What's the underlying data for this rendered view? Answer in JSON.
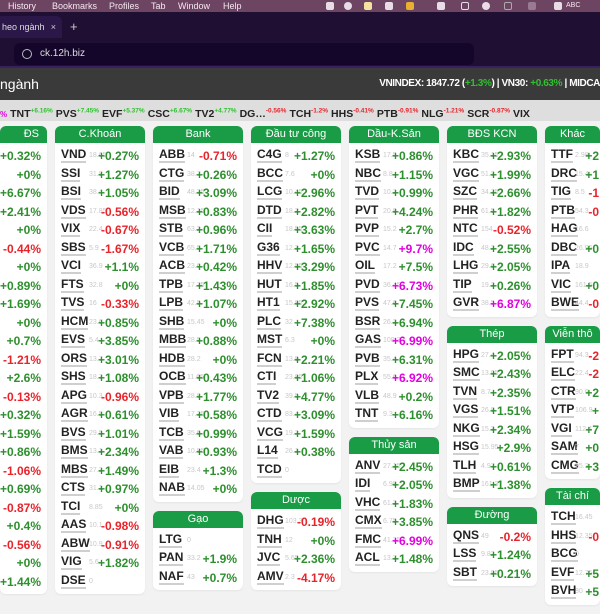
{
  "menubar": {
    "items": [
      "History",
      "Bookmarks",
      "Profiles",
      "Tab",
      "Window",
      "Help"
    ],
    "input_label": "ABC"
  },
  "browser": {
    "tab_title": "heo ngành",
    "tab_close": "×",
    "new_tab": "+",
    "url": "ck.12h.biz"
  },
  "header": {
    "title": "ngành",
    "vnindex_label": "VNINDEX: 1847.72 (",
    "vnindex_change": "+1.3%",
    "vn30_label": ") | VN30: ",
    "vn30_change": "+0.63%",
    "midcap_label": " | MIDCA"
  },
  "ticker_strip": [
    {
      "s": "%",
      "p": "",
      "c": "g"
    },
    {
      "s": "TNT",
      "p": "+6.16%",
      "c": "g"
    },
    {
      "s": "PVS",
      "p": "+7.45%",
      "c": "g"
    },
    {
      "s": "EVF",
      "p": "+5.37%",
      "c": "g"
    },
    {
      "s": "CSC",
      "p": "+6.67%",
      "c": "g"
    },
    {
      "s": "TV2",
      "p": "+4.77%",
      "c": "g"
    },
    {
      "s": "DG…",
      "p": "-0.56%",
      "c": "r"
    },
    {
      "s": "TCH",
      "p": "-1.2%",
      "c": "r"
    },
    {
      "s": "HHS",
      "p": "-0.41%",
      "c": "r"
    },
    {
      "s": "PTB",
      "p": "-0.91%",
      "c": "r"
    },
    {
      "s": "NLG",
      "p": "-1.21%",
      "c": "r"
    },
    {
      "s": "SCR",
      "p": "-0.87%",
      "c": "r"
    },
    {
      "s": "VIX",
      "p": "",
      "c": "g"
    }
  ],
  "colors": {
    "header": "#1a9c47",
    "up": "#2e8f2e",
    "down": "#e8232a",
    "ceiling": "#e100e1"
  },
  "columns": [
    [
      {
        "title": "ĐS",
        "rows": [
          [
            "",
            "",
            "+0.32%"
          ],
          [
            "",
            "",
            "+0%"
          ],
          [
            "",
            "",
            "+6.67%"
          ],
          [
            "",
            "",
            "+2.41%"
          ],
          [
            "",
            "",
            "+0%"
          ],
          [
            "",
            "",
            "-0.44%"
          ],
          [
            "",
            "",
            "+0%"
          ],
          [
            "",
            "",
            "+0.89%"
          ],
          [
            "",
            "",
            "+1.69%"
          ],
          [
            "",
            "",
            "+0%"
          ],
          [
            "",
            "",
            "+0.7%"
          ],
          [
            "",
            "",
            "-1.21%"
          ],
          [
            "",
            "",
            "+2.6%"
          ],
          [
            "",
            "",
            "-0.13%"
          ],
          [
            "",
            "",
            "+0.32%"
          ],
          [
            "",
            "",
            "+1.59%"
          ],
          [
            "",
            "",
            "+0.86%"
          ],
          [
            "",
            "",
            "-1.06%"
          ],
          [
            "",
            "",
            "+0.69%"
          ],
          [
            "",
            "",
            "-0.87%"
          ],
          [
            "",
            "",
            "+0.4%"
          ],
          [
            "",
            "",
            "-0.56%"
          ],
          [
            "",
            "",
            "+0%"
          ],
          [
            "",
            "",
            "+1.44%"
          ]
        ]
      }
    ],
    [
      {
        "title": "C.Khoán",
        "rows": [
          [
            "VND",
            "18.65",
            "+0.27%"
          ],
          [
            "SSI",
            "31.8",
            "+1.27%"
          ],
          [
            "BSI",
            "38.4",
            "+1.05%"
          ],
          [
            "VDS",
            "17.85",
            "-0.56%"
          ],
          [
            "VIX",
            "22.4",
            "-0.67%"
          ],
          [
            "SBS",
            "5.9",
            "-1.67%"
          ],
          [
            "VCI",
            "36.9",
            "+1.1%"
          ],
          [
            "FTS",
            "32.8",
            "+0%"
          ],
          [
            "TVS",
            "16",
            "-0.33%"
          ],
          [
            "HCM",
            "23.6",
            "+0.85%"
          ],
          [
            "EVS",
            "5.4",
            "+3.85%"
          ],
          [
            "ORS",
            "13.7",
            "+3.01%"
          ],
          [
            "SHS",
            "18.7",
            "+1.08%"
          ],
          [
            "APG",
            "10.3",
            "-0.96%"
          ],
          [
            "AGR",
            "16.5",
            "+0.61%"
          ],
          [
            "BVS",
            "29.5",
            "+1.01%"
          ],
          [
            "BMS",
            "13.1",
            "+2.34%"
          ],
          [
            "MBS",
            "27.2",
            "+1.49%"
          ],
          [
            "CTS",
            "31.1",
            "+0.97%"
          ],
          [
            "TCI",
            "8.85",
            "+0%"
          ],
          [
            "AAS",
            "10.1",
            "-0.98%"
          ],
          [
            "ABW",
            "10.9",
            "-0.91%"
          ],
          [
            "VIG",
            "5.6",
            "+1.82%"
          ],
          [
            "DSE",
            "0",
            ""
          ]
        ]
      }
    ],
    [
      {
        "title": "Bank",
        "rows": [
          [
            "ABB",
            "14",
            "-0.71%"
          ],
          [
            "CTG",
            "38.7",
            "+0.26%"
          ],
          [
            "BID",
            "48.35",
            "+3.09%"
          ],
          [
            "MSB",
            "12.15",
            "+0.83%"
          ],
          [
            "STB",
            "63.2",
            "+0.96%"
          ],
          [
            "VCB",
            "65.5",
            "+1.71%"
          ],
          [
            "ACB",
            "23.6",
            "+0.42%"
          ],
          [
            "TPB",
            "17.75",
            "+1.43%"
          ],
          [
            "LPB",
            "42.5",
            "+1.07%"
          ],
          [
            "SHB",
            "15.45",
            "+0%"
          ],
          [
            "MBB",
            "28.5",
            "+0.88%"
          ],
          [
            "HDB",
            "28.2",
            "+0%"
          ],
          [
            "OCB",
            "11.65",
            "+0.43%"
          ],
          [
            "VPB",
            "28.8",
            "+1.77%"
          ],
          [
            "VIB",
            "17.35",
            "+0.58%"
          ],
          [
            "TCB",
            "35.6",
            "+0.99%"
          ],
          [
            "VAB",
            "10.85",
            "+0.93%"
          ],
          [
            "EIB",
            "23.4",
            "+1.3%"
          ],
          [
            "NAB",
            "14.05",
            "+0%"
          ]
        ]
      },
      {
        "title": "Gạo",
        "rows": [
          [
            "LTG",
            "0",
            ""
          ],
          [
            "PAN",
            "33.2",
            "+1.9%"
          ],
          [
            "NAF",
            "43",
            "+0.7%"
          ]
        ]
      }
    ],
    [
      {
        "title": "Đầu tư công",
        "rows": [
          [
            "C4G",
            "8",
            "+1.27%"
          ],
          [
            "BCC",
            "7.6",
            "+0%"
          ],
          [
            "LCG",
            "10.45",
            "+2.96%"
          ],
          [
            "DTD",
            "18.2",
            "+2.82%"
          ],
          [
            "CII",
            "18.55",
            "+3.63%"
          ],
          [
            "G36",
            "12.3",
            "+1.65%"
          ],
          [
            "HHV",
            "12.55",
            "+3.29%"
          ],
          [
            "HUT",
            "16.5",
            "+1.85%"
          ],
          [
            "HT1",
            "15.85",
            "+2.92%"
          ],
          [
            "PLC",
            "32",
            "+7.38%"
          ],
          [
            "MST",
            "6.3",
            "+0%"
          ],
          [
            "FCN",
            "13.9",
            "+2.21%"
          ],
          [
            "CTI",
            "23.85",
            "+1.06%"
          ],
          [
            "TV2",
            "39.5",
            "+4.77%"
          ],
          [
            "CTD",
            "83.4",
            "+3.09%"
          ],
          [
            "VCG",
            "19.2",
            "+1.59%"
          ],
          [
            "L14",
            "26.1",
            "+0.38%"
          ],
          [
            "TCD",
            "0",
            ""
          ]
        ]
      },
      {
        "title": "Dược",
        "rows": [
          [
            "DHG",
            "103.3",
            "-0.19%"
          ],
          [
            "TNH",
            "12",
            "+0%"
          ],
          [
            "JVC",
            "5.65",
            "+2.36%"
          ],
          [
            "AMV",
            "2.3",
            "-4.17%"
          ]
        ]
      }
    ],
    [
      {
        "title": "Dầu-K.Sản",
        "rows": [
          [
            "KSB",
            "17.5",
            "+0.86%"
          ],
          [
            "NBC",
            "8.8",
            "+1.15%"
          ],
          [
            "TVD",
            "10.2",
            "+0.99%"
          ],
          [
            "PVT",
            "20.9",
            "+4.24%"
          ],
          [
            "PVP",
            "15.2",
            "+2.7%"
          ],
          [
            "PVC",
            "14.7",
            "+9.7%",
            "m"
          ],
          [
            "OIL",
            "17.2",
            "+7.5%"
          ],
          [
            "PVD",
            "36.45",
            "+6.73%",
            "m"
          ],
          [
            "PVS",
            "47.6",
            "+7.45%"
          ],
          [
            "BSR",
            "26.2",
            "+6.94%"
          ],
          [
            "GAS",
            "108.3",
            "+6.99%",
            "m"
          ],
          [
            "PVB",
            "35.4",
            "+6.31%"
          ],
          [
            "PLX",
            "55.6",
            "+6.92%",
            "m"
          ],
          [
            "VLB",
            "48.9",
            "+0.2%"
          ],
          [
            "TNT",
            "9.3",
            "+6.16%"
          ]
        ]
      },
      {
        "title": "Thủy sản",
        "rows": [
          [
            "ANV",
            "27.15",
            "+2.45%"
          ],
          [
            "IDI",
            "6.98",
            "+2.05%"
          ],
          [
            "VHC",
            "61.2",
            "+1.83%"
          ],
          [
            "CMX",
            "6.75",
            "+3.85%"
          ],
          [
            "FMC",
            "41.35",
            "+6.99%",
            "m"
          ],
          [
            "ACL",
            "13.7",
            "+1.48%"
          ]
        ]
      }
    ],
    [
      {
        "title": "BĐS KCN",
        "rows": [
          [
            "KBC",
            "35.15",
            "+2.93%"
          ],
          [
            "VGC",
            "51.3",
            "+1.99%"
          ],
          [
            "SZC",
            "34.75",
            "+2.66%"
          ],
          [
            "PHR",
            "61.5",
            "+1.82%"
          ],
          [
            "NTC",
            "154",
            "-0.52%"
          ],
          [
            "IDC",
            "48.2",
            "+2.55%"
          ],
          [
            "LHG",
            "29.6",
            "+2.05%"
          ],
          [
            "TIP",
            "19.2",
            "+0.26%"
          ],
          [
            "GVR",
            "38.5",
            "+6.87%",
            "m"
          ]
        ]
      },
      {
        "title": "Thép",
        "rows": [
          [
            "HPG",
            "27.4",
            "+2.05%"
          ],
          [
            "SMC",
            "13.05",
            "+2.43%"
          ],
          [
            "TVN",
            "8.7",
            "+2.35%"
          ],
          [
            "VGS",
            "26.9",
            "+1.51%"
          ],
          [
            "NKG",
            "15.3",
            "+2.34%"
          ],
          [
            "HSG",
            "15.95",
            "+2.9%"
          ],
          [
            "TLH",
            "4.97",
            "+0.61%"
          ],
          [
            "BMP",
            "161.3",
            "+1.38%"
          ]
        ]
      },
      {
        "title": "Đường",
        "rows": [
          [
            "QNS",
            "49",
            "-0.2%"
          ],
          [
            "LSS",
            "9.82",
            "+1.24%"
          ],
          [
            "SBT",
            "23.95",
            "+0.21%"
          ]
        ]
      }
    ],
    [
      {
        "title": "Khác",
        "rows": [
          [
            "TTF",
            "2.98",
            "+2"
          ],
          [
            "DRC",
            "15.4",
            "+1"
          ],
          [
            "TIG",
            "8.5",
            "-1"
          ],
          [
            "PTB",
            "54.3",
            "-0"
          ],
          [
            "HAG",
            "16.6",
            ""
          ],
          [
            "DBC",
            "26.95",
            "+0"
          ],
          [
            "IPA",
            "18.9",
            ""
          ],
          [
            "VIC",
            "161.5",
            "+0"
          ],
          [
            "BWE",
            "44.4",
            "-0"
          ]
        ]
      },
      {
        "title": "Viễn thô",
        "rows": [
          [
            "FPT",
            "94.3",
            "-2"
          ],
          [
            "ELC",
            "22.4",
            "-2"
          ],
          [
            "CTR",
            "90.6",
            "+2"
          ],
          [
            "VTP",
            "106.9",
            "+"
          ],
          [
            "VGI",
            "112.4",
            "+7"
          ],
          [
            "SAM",
            "7",
            "+0"
          ],
          [
            "CMG",
            "35.3",
            "+3"
          ]
        ]
      },
      {
        "title": "Tài chí",
        "rows": [
          [
            "TCH",
            "16.45",
            ""
          ],
          [
            "HHS",
            "12.35",
            "-0"
          ],
          [
            "BCG",
            "0",
            ""
          ],
          [
            "EVF",
            "12.75",
            "+5"
          ],
          [
            "BVH",
            "80",
            "+5"
          ]
        ]
      }
    ]
  ]
}
